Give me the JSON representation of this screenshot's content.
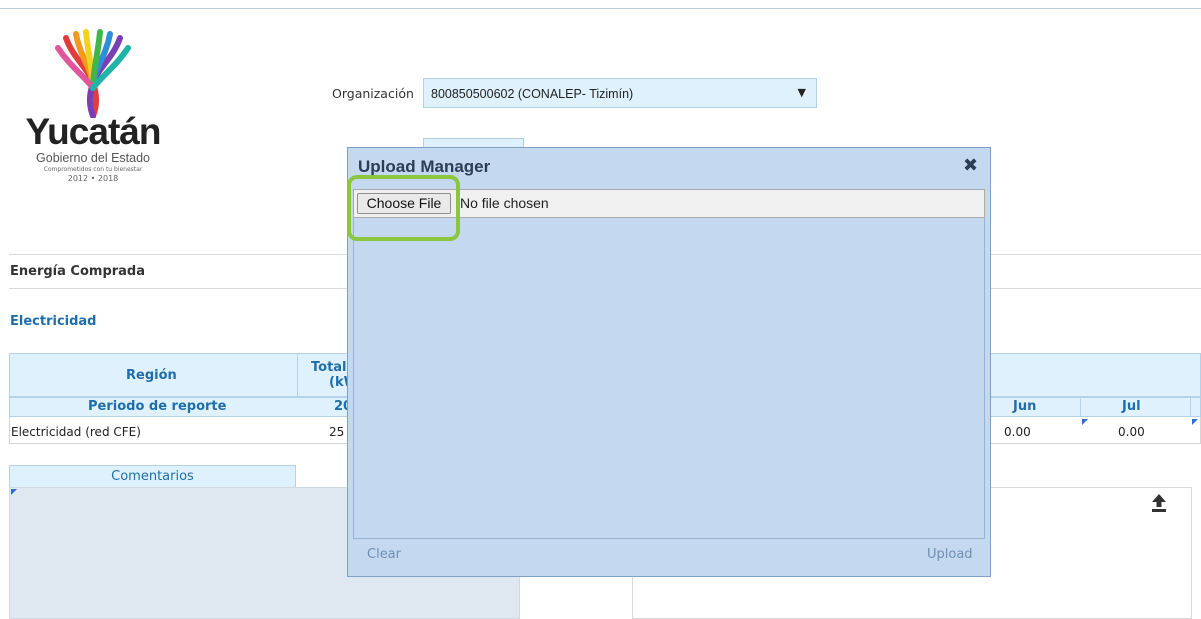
{
  "logo": {
    "word": "Yucatán",
    "subtitle": "Gobierno del Estado",
    "tagline": "Comprometidos con tu bienestar",
    "years": "2012 • 2018"
  },
  "organization": {
    "label": "Organización",
    "selected": "800850500602 (CONALEP- Tizimín)"
  },
  "sections": {
    "energy": "Energía Comprada",
    "electricity": "Electricidad"
  },
  "table": {
    "head_region": "Región",
    "head_total_1": "Total",
    "head_total_2": "(kW",
    "head_period": "Periodo de reporte",
    "head_year": "20",
    "head_jun": "Jun",
    "head_jul": "Jul",
    "row_label": "Electricidad (red CFE)",
    "row_total": "25",
    "row_jun": "0.00",
    "row_jul": "0.00"
  },
  "comments": {
    "tab": "Comentarios"
  },
  "modal": {
    "title": "Upload Manager",
    "close_icon": "close-icon",
    "choose_file": "Choose File",
    "no_file": "No file chosen",
    "clear": "Clear",
    "upload": "Upload"
  },
  "colors": {
    "accent": "#1f6ea9",
    "header_fill": "#dff1fc",
    "modal_bg": "#c4d8ef",
    "highlight": "#8cc63f"
  }
}
